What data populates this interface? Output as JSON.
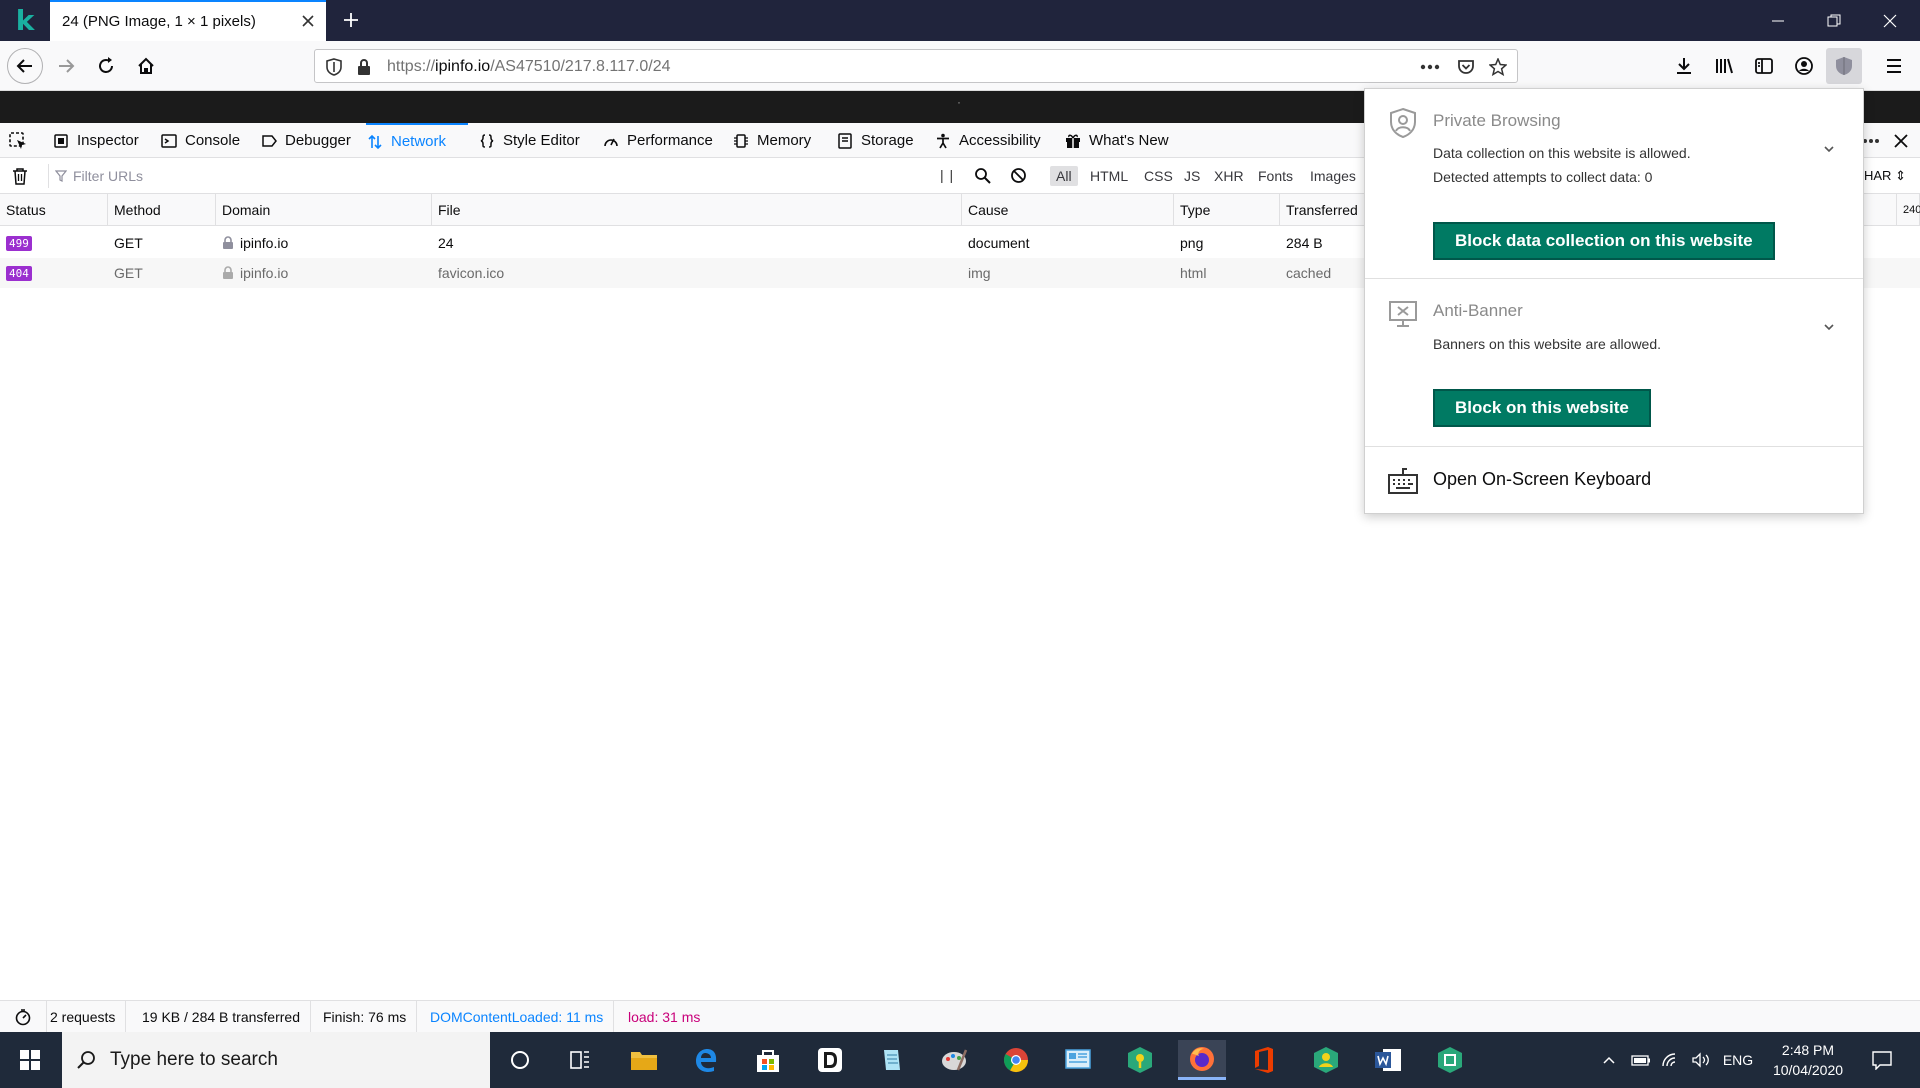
{
  "browser": {
    "tab_title": "24 (PNG Image, 1 × 1 pixels)",
    "url_prefix": "https://",
    "url_domain": "ipinfo.io",
    "url_path": "/AS47510/217.8.117.0/24",
    "page_dot": "·"
  },
  "devtools": {
    "tabs": [
      {
        "label": "Inspector",
        "icon": "inspector-icon"
      },
      {
        "label": "Console",
        "icon": "console-icon"
      },
      {
        "label": "Debugger",
        "icon": "debugger-icon"
      },
      {
        "label": "Network",
        "icon": "network-icon",
        "selected": true
      },
      {
        "label": "Style Editor",
        "icon": "style-editor-icon"
      },
      {
        "label": "Performance",
        "icon": "performance-icon"
      },
      {
        "label": "Memory",
        "icon": "memory-icon"
      },
      {
        "label": "Storage",
        "icon": "storage-icon"
      },
      {
        "label": "Accessibility",
        "icon": "accessibility-icon"
      },
      {
        "label": "What's New",
        "icon": "gift-icon"
      }
    ],
    "filter_placeholder": "Filter URLs",
    "pause_glyph": "| |",
    "filter_types": [
      "All",
      "HTML",
      "CSS",
      "JS",
      "XHR",
      "Fonts",
      "Images"
    ],
    "har_label": "HAR",
    "col_edge": "240",
    "columns": [
      "Status",
      "Method",
      "Domain",
      "File",
      "Cause",
      "Type",
      "Transferred"
    ],
    "rows": [
      {
        "status": "499",
        "method": "GET",
        "domain": "ipinfo.io",
        "file": "24",
        "cause": "document",
        "type": "png",
        "transferred": "284 B"
      },
      {
        "status": "404",
        "method": "GET",
        "domain": "ipinfo.io",
        "file": "favicon.ico",
        "cause": "img",
        "type": "html",
        "transferred": "cached"
      }
    ],
    "footer": {
      "requests": "2 requests",
      "size": "19 KB / 284 B transferred",
      "finish": "Finish: 76 ms",
      "dcl": "DOMContentLoaded: 11 ms",
      "load": "load: 31 ms"
    }
  },
  "popup": {
    "private": {
      "title": "Private Browsing",
      "line1": "Data collection on this website is allowed.",
      "line2": "Detected attempts to collect data: 0",
      "button": "Block data collection on this website"
    },
    "antibanner": {
      "title": "Anti-Banner",
      "line1": "Banners on this website are allowed.",
      "button": "Block on this website"
    },
    "keyboard": "Open On-Screen Keyboard"
  },
  "taskbar": {
    "search_placeholder": "Type here to search",
    "time": "2:48 PM",
    "date": "10/04/2020",
    "lang": "ENG"
  },
  "colors": {
    "accent": "#0a84ff",
    "kaspersky_green": "#007a63",
    "status_purple": "#9b2fcf"
  }
}
